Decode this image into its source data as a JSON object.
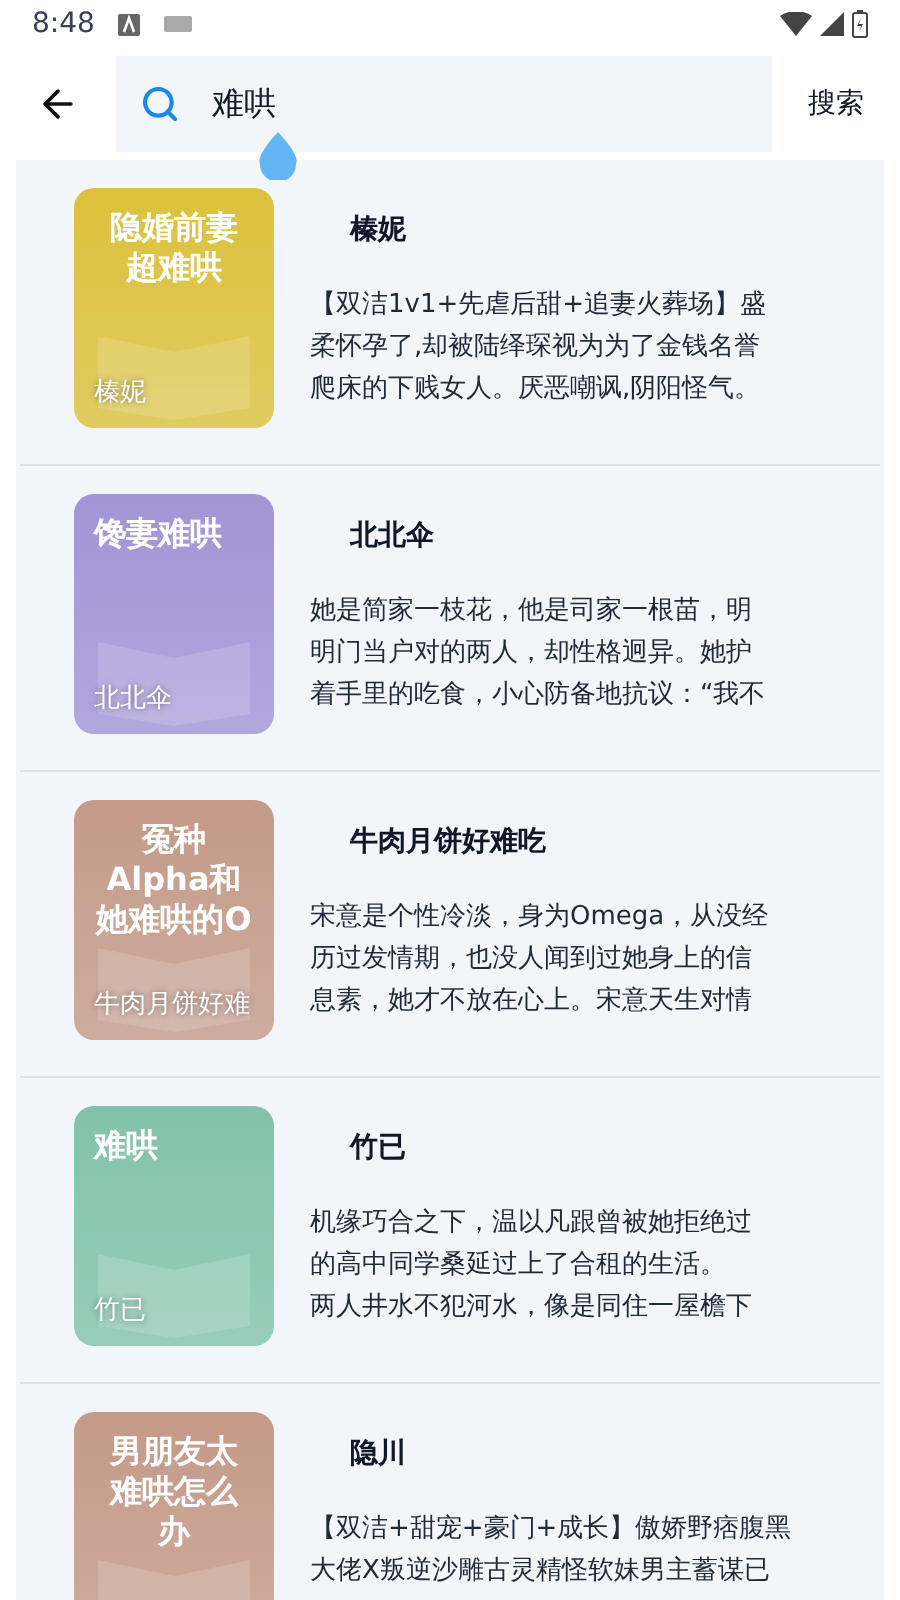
{
  "status_bar": {
    "time": "8:48"
  },
  "search": {
    "value": "难哄",
    "button": "搜索"
  },
  "results": [
    {
      "cover_title": [
        "隐婚前妻",
        "超难哄"
      ],
      "cover_author": "榛妮",
      "color": "#dcc13a",
      "author": "榛妮",
      "description": [
        "【双洁1v1+先虐后甜+追妻火葬场】盛",
        "柔怀孕了,却被陆绎琛视为为了金钱名誉",
        "爬床的下贱女人。厌恶嘲讽,阴阳怪气。"
      ]
    },
    {
      "cover_title": [
        "馋妻难哄"
      ],
      "cover_author": "北北伞",
      "color": "#a294d6",
      "author": "北北伞",
      "description": [
        "她是简家一枝花，他是司家一根苗，明",
        "明门当户对的两人，却性格迥异。她护",
        "着手里的吃食，小心防备地抗议：“我不"
      ]
    },
    {
      "cover_title": [
        "冤种",
        "Alpha和",
        "她难哄的O"
      ],
      "cover_author": "牛肉月饼好难",
      "color": "#c49a88",
      "author": "牛肉月饼好难吃",
      "description": [
        "宋意是个性冷淡，身为Omega，从没经",
        "历过发情期，也没人闻到过她身上的信",
        "息素，她才不放在心上。宋意天生对情"
      ]
    },
    {
      "cover_title": [
        "难哄"
      ],
      "cover_author": "竹已",
      "color": "#82c2aa",
      "author": "竹已",
      "description": [
        "机缘巧合之下，温以凡跟曾被她拒绝过",
        "的高中同学桑延过上了合租的生活。",
        "两人井水不犯河水，像是同住一屋檐下"
      ]
    },
    {
      "cover_title": [
        "男朋友太",
        "难哄怎么",
        "办"
      ],
      "color": "#c49a88",
      "author": "隐川",
      "description": [
        "【双洁+甜宠+豪门+成长】傲娇野痞腹黑",
        "大佬X叛逆沙雕古灵精怪软妹男主蓄谋已"
      ]
    }
  ]
}
